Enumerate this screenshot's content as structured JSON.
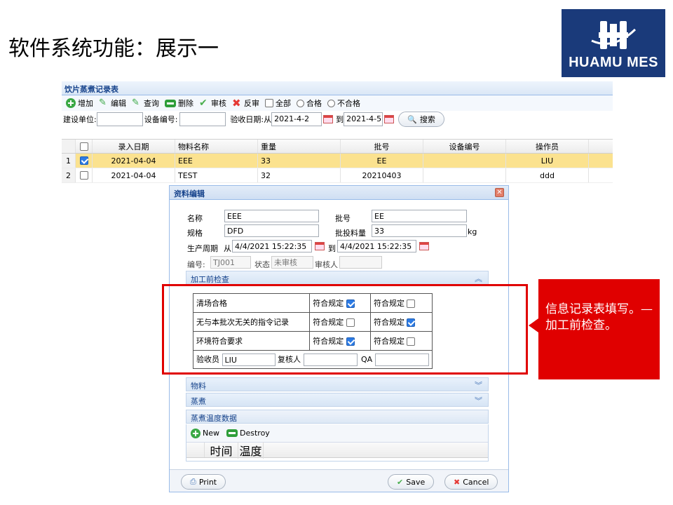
{
  "slide": {
    "title": "软件系统功能：展示一"
  },
  "logo": {
    "text": "HUAMU MES"
  },
  "panel": {
    "title": "饮片蒸煮记录表"
  },
  "toolbar": {
    "add": "增加",
    "edit": "编辑",
    "query": "查询",
    "delete": "删除",
    "approve": "审核",
    "unapprove": "反审",
    "all": "全部",
    "pass": "合格",
    "fail": "不合格"
  },
  "filter": {
    "unit_label": "建设单位:",
    "unit_value": "",
    "device_label": "设备编号:",
    "device_value": "",
    "date_label": "验收日期:从",
    "date_from": "2021-4-2",
    "to_label": "到",
    "date_to": "2021-4-5",
    "search": "搜索"
  },
  "grid": {
    "headers": [
      "录入日期",
      "物料名称",
      "重量",
      "批号",
      "设备编号",
      "操作员"
    ],
    "rows": [
      {
        "num": "1",
        "checked": true,
        "date": "2021-04-04",
        "material": "EEE",
        "weight": "33",
        "batch": "EE",
        "device": "",
        "operator": "LIU"
      },
      {
        "num": "2",
        "checked": false,
        "date": "2021-04-04",
        "material": "TEST",
        "weight": "32",
        "batch": "20210403",
        "device": "",
        "operator": "ddd"
      }
    ]
  },
  "dialog": {
    "title": "资料编辑",
    "name_label": "名称",
    "name_value": "EEE",
    "batch_label": "批号",
    "batch_value": "EE",
    "spec_label": "规格",
    "spec_value": "DFD",
    "qty_label": "批投料量",
    "qty_value": "33",
    "qty_unit": "kg",
    "period_label": "生产周期",
    "period_from_label": "从",
    "period_from": "4/4/2021 15:22:35",
    "period_to_label": "到",
    "period_to": "4/4/2021 15:22:35",
    "code_label": "编号:",
    "code_value": "TJ001",
    "status_label": "状态",
    "status_value": "未审核",
    "reviewer_label": "审核人",
    "reviewer_value": "",
    "sec_preprocess": "加工前检查",
    "check_rows": [
      {
        "item": "清场合格",
        "a_label": "符合规定",
        "a": true,
        "b_label": "符合规定",
        "b": false
      },
      {
        "item": "无与本批次无关的指令记录",
        "a_label": "符合规定",
        "a": false,
        "b_label": "符合规定",
        "b": true
      },
      {
        "item": "环境符合要求",
        "a_label": "符合规定",
        "a": true,
        "b_label": "符合规定",
        "b": false
      }
    ],
    "inspector_label": "验收员",
    "inspector_value": "LIU",
    "rechecker_label": "复核人",
    "rechecker_value": "",
    "qa_label": "QA",
    "qa_value": "",
    "sec_material": "物料",
    "sec_cook": "蒸煮",
    "sec_temp": "蒸煮温度数据",
    "temp_new": "New",
    "temp_destroy": "Destroy",
    "temp_headers": [
      "时间",
      "温度"
    ],
    "print": "Print",
    "save": "Save",
    "cancel": "Cancel"
  },
  "callout": {
    "text": "信息记录表填写。—加工前检查。"
  },
  "colors": {
    "callout": "#e00000",
    "selected_row": "#fbe28f",
    "logo_bg": "#1a3a7a",
    "header_text": "#15428b"
  }
}
